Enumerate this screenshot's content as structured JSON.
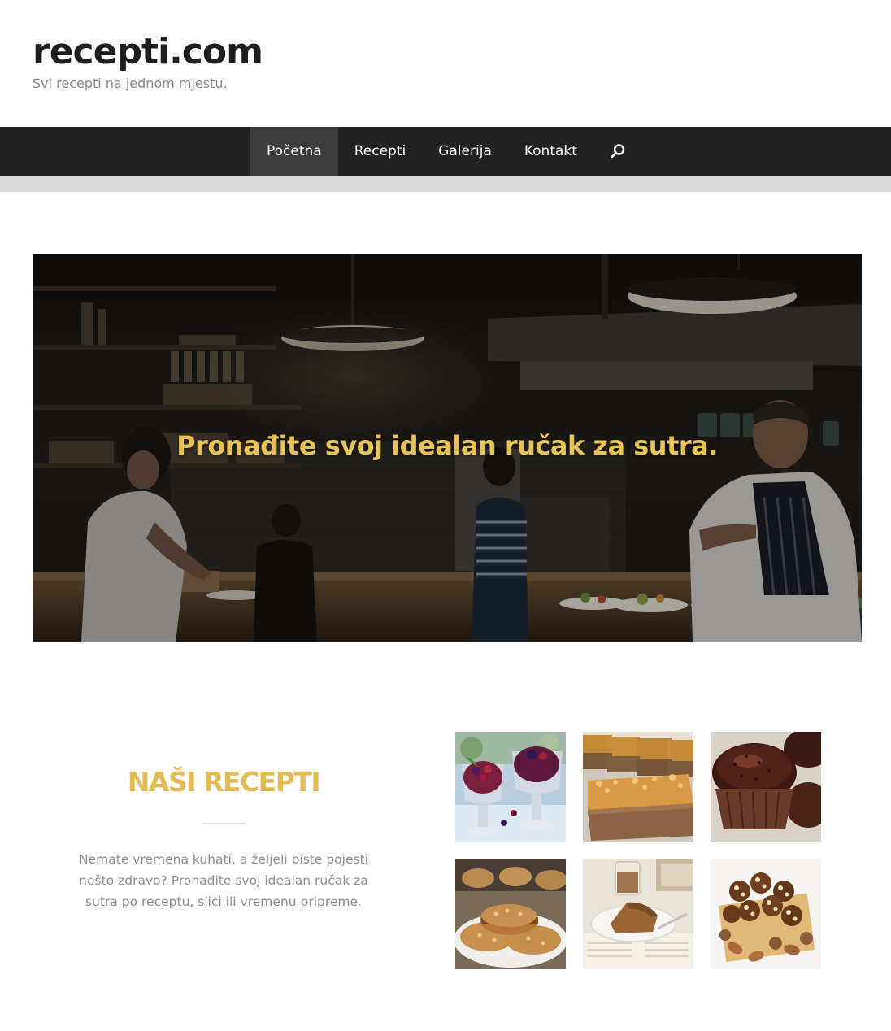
{
  "header": {
    "site_title": "recepti.com",
    "tagline": "Svi recepti na jednom mjestu."
  },
  "nav": {
    "items": [
      {
        "label": "Početna",
        "active": true
      },
      {
        "label": "Recepti",
        "active": false
      },
      {
        "label": "Galerija",
        "active": false
      },
      {
        "label": "Kontakt",
        "active": false
      }
    ],
    "search_icon": "search-icon"
  },
  "hero": {
    "headline": "Pronađite svoj idealan ručak za sutra."
  },
  "recipes": {
    "heading": "NAŠI RECEPTI",
    "description": "Nemate vremena kuhati, a željeli biste pojesti nešto zdravo? Pronađite svoj idealan ručak za sutra po receptu, slici ili vremenu pripreme.",
    "images": [
      {
        "name": "berry-dessert-cups"
      },
      {
        "name": "oat-bars"
      },
      {
        "name": "chocolate-cupcakes"
      },
      {
        "name": "oat-cookies"
      },
      {
        "name": "coffee-cake-slice"
      },
      {
        "name": "nut-bites"
      }
    ]
  },
  "colors": {
    "nav_background": "#222222",
    "nav_active": "#3c3c3c",
    "accent_gold": "#e7c35a",
    "title_dark": "#1e1e1e",
    "muted_text": "#8a8a8a"
  }
}
